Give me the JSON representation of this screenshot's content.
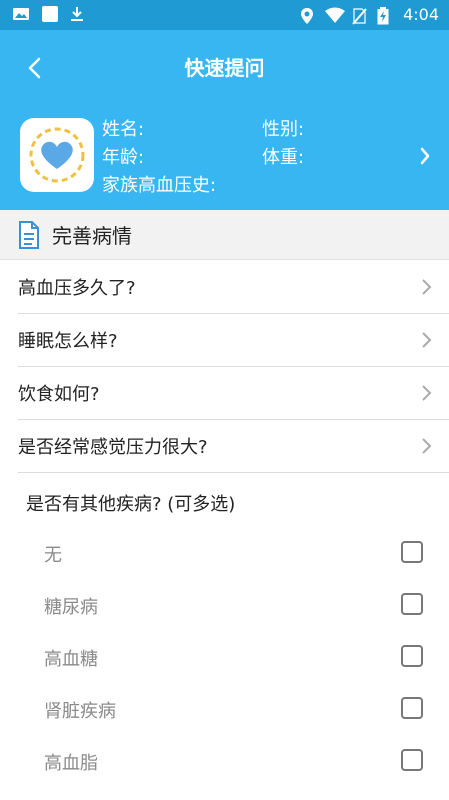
{
  "status_bar": {
    "time": "4:04",
    "icons": [
      "image-icon",
      "notification-icon",
      "download-icon",
      "location-icon",
      "wifi-icon",
      "no-sim-icon",
      "battery-charging-icon"
    ]
  },
  "header": {
    "title": "快速提问",
    "profile": {
      "name_label": "姓名:",
      "age_label": "年龄:",
      "history_label": "家族高血压史:",
      "gender_label": "性别:",
      "weight_label": "体重:"
    }
  },
  "section": {
    "title": "完善病情"
  },
  "questions": [
    {
      "label": "高血压多久了?"
    },
    {
      "label": "睡眠怎么样?"
    },
    {
      "label": "饮食如何?"
    },
    {
      "label": "是否经常感觉压力很大?"
    }
  ],
  "multi_select": {
    "title": "是否有其他疾病? (可多选)",
    "options": [
      {
        "label": "无",
        "checked": false
      },
      {
        "label": "糖尿病",
        "checked": false
      },
      {
        "label": "高血糖",
        "checked": false
      },
      {
        "label": "肾脏疾病",
        "checked": false
      },
      {
        "label": "高血脂",
        "checked": false
      }
    ]
  },
  "colors": {
    "status_bar": "#1f9ad2",
    "header": "#37b6f1",
    "heart": "#5aa9e6"
  }
}
